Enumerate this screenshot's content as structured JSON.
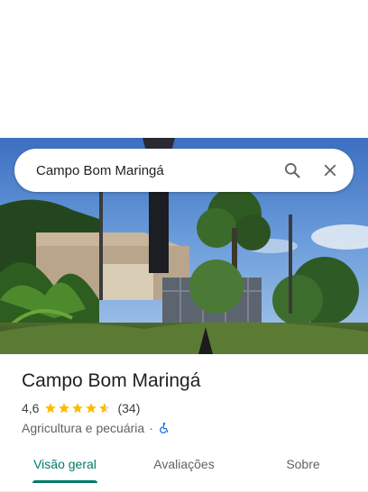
{
  "search": {
    "value": "Campo Bom Maringá",
    "search_icon": "search-icon",
    "close_icon": "close-icon"
  },
  "place": {
    "title": "Campo Bom Maringá",
    "rating": "4,6",
    "stars": 4.6,
    "reviews_count": "(34)",
    "category": "Agricultura e pecuária",
    "separator": "·",
    "accessibility_icon": "wheelchair-icon"
  },
  "tabs": [
    {
      "label": "Visão geral",
      "active": true
    },
    {
      "label": "Avaliações",
      "active": false
    },
    {
      "label": "Sobre",
      "active": false
    }
  ],
  "colors": {
    "accent": "#00796b",
    "star": "#fbbc04",
    "accessibility": "#1a73e8"
  }
}
